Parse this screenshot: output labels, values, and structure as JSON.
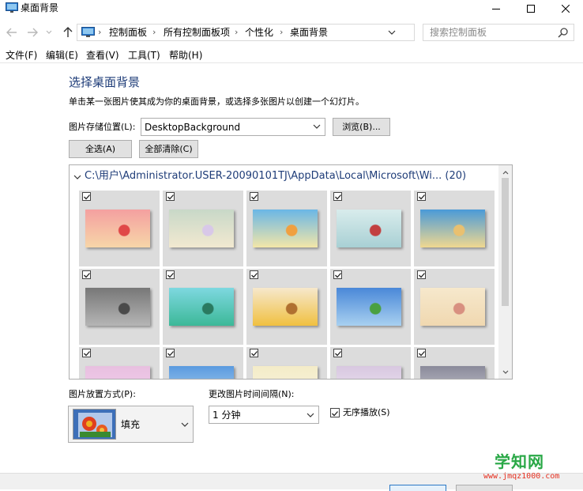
{
  "window": {
    "title": "桌面背景",
    "icon": "control-panel-display-icon"
  },
  "address": {
    "crumbs": [
      "控制面板",
      "所有控制面板项",
      "个性化",
      "桌面背景"
    ],
    "search_placeholder": "搜索控制面板"
  },
  "menu": [
    {
      "label": "文件(F)"
    },
    {
      "label": "编辑(E)"
    },
    {
      "label": "查看(V)"
    },
    {
      "label": "工具(T)"
    },
    {
      "label": "帮助(H)"
    }
  ],
  "content": {
    "heading": "选择桌面背景",
    "description": "单击某一张图片使其成为你的桌面背景，或选择多张图片以创建一个幻灯片。",
    "location_label": "图片存储位置(L):",
    "location_value": "DesktopBackground",
    "browse_label": "浏览(B)...",
    "select_all_label": "全选(A)",
    "clear_all_label": "全部清除(C)"
  },
  "gallery": {
    "group_path": "C:\\用户\\Administrator.USER-20090101TJ\\AppData\\Local\\Microsoft\\Wi... (20)",
    "thumbnails": [
      {
        "name": "cartoon-fox-wallpaper",
        "checked": true,
        "colors": [
          "#f4a0a0",
          "#f7d6a8",
          "#e04848"
        ]
      },
      {
        "name": "telegraph-pole-wallpaper",
        "checked": true,
        "colors": [
          "#c8d8c8",
          "#f2e9d0",
          "#d8c8e8"
        ]
      },
      {
        "name": "cartoon-beach-wallpaper",
        "checked": true,
        "colors": [
          "#6ab6e6",
          "#f3e6a8",
          "#f0a040"
        ]
      },
      {
        "name": "winter-bench-wallpaper",
        "checked": true,
        "colors": [
          "#d9ecec",
          "#a8d0d4",
          "#c24040"
        ]
      },
      {
        "name": "sand-heart-wallpaper",
        "checked": true,
        "colors": [
          "#4a9ad8",
          "#f0d890",
          "#e9c070"
        ]
      },
      {
        "name": "grey-street-wallpaper",
        "checked": true,
        "colors": [
          "#777777",
          "#b5b5b5",
          "#4a4a4a"
        ]
      },
      {
        "name": "green-sky-wallpaper",
        "checked": true,
        "colors": [
          "#7ed8e0",
          "#3cb898",
          "#2a7a60"
        ]
      },
      {
        "name": "sunflowers-wallpaper",
        "checked": true,
        "colors": [
          "#f6e8cc",
          "#f0c040",
          "#b07030"
        ]
      },
      {
        "name": "meadow-sky-wallpaper",
        "checked": true,
        "colors": [
          "#4a88d8",
          "#a8d0f0",
          "#4aa040"
        ]
      },
      {
        "name": "girl-by-sea-wallpaper",
        "checked": true,
        "colors": [
          "#f6e8cc",
          "#f0d8b0",
          "#d89080"
        ]
      },
      {
        "name": "pink-scene-wallpaper",
        "checked": true,
        "colors": [
          "#e8c0e0",
          "#f6d0f0",
          "#d04060"
        ]
      },
      {
        "name": "blue-clouds-wallpaper",
        "checked": true,
        "colors": [
          "#5a9ae0",
          "#b8d8f0",
          "#f0f0f0"
        ]
      },
      {
        "name": "cream-scene-wallpaper",
        "checked": true,
        "colors": [
          "#f4ecc8",
          "#f8f4e0",
          "#e0d090"
        ]
      },
      {
        "name": "lilac-scene-wallpaper",
        "checked": true,
        "colors": [
          "#d8c8e0",
          "#f0e8f4",
          "#b8a8c8"
        ]
      },
      {
        "name": "dusk-scene-wallpaper",
        "checked": true,
        "colors": [
          "#8a8a9a",
          "#d0d0d8",
          "#505060"
        ]
      }
    ]
  },
  "bottom": {
    "position_label": "图片放置方式(P):",
    "position_value": "填充",
    "interval_label": "更改图片时间间隔(N):",
    "interval_value": "1 分钟",
    "shuffle_label": "无序播放(S)",
    "shuffle_checked": true
  },
  "watermark": {
    "main": "学知网",
    "url": "www.jmqz1000.com"
  }
}
